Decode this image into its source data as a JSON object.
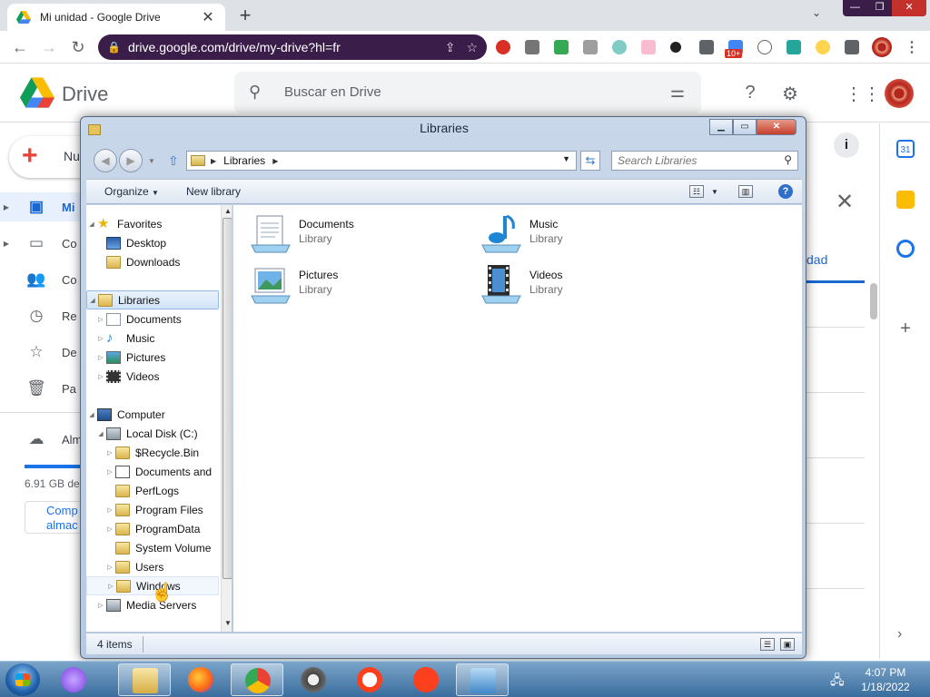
{
  "browser": {
    "tab_title": "Mi unidad - Google Drive",
    "url": "drive.google.com/drive/my-drive?hl=fr",
    "ext_badge": "10+"
  },
  "drive": {
    "app_name": "Drive",
    "search_placeholder": "Buscar en Drive",
    "new_label": "Nu",
    "nav": [
      {
        "label": "Mi",
        "icon": "my-drive-icon"
      },
      {
        "label": "Co",
        "icon": "computers-icon"
      },
      {
        "label": "Co",
        "icon": "shared-icon"
      },
      {
        "label": "Re",
        "icon": "recent-icon"
      },
      {
        "label": "De",
        "icon": "starred-icon"
      },
      {
        "label": "Pa",
        "icon": "trash-icon"
      }
    ],
    "storage_label": "Alm",
    "storage_text": "6.91 GB de",
    "buy_storage_label": "Comp almac",
    "activity_tab": "dad",
    "accent_color": "#1a73e8"
  },
  "explorer": {
    "title": "Libraries",
    "address_crumb": "Libraries",
    "search_placeholder": "Search Libraries",
    "toolbar": {
      "organize": "Organize",
      "new_library": "New library"
    },
    "nav": {
      "favorites": "Favorites",
      "desktop": "Desktop",
      "downloads": "Downloads",
      "libraries": "Libraries",
      "documents": "Documents",
      "music": "Music",
      "pictures": "Pictures",
      "videos": "Videos",
      "computer": "Computer",
      "local_disk": "Local Disk (C:)",
      "recycle": "$Recycle.Bin",
      "docs_and": "Documents and",
      "perflogs": "PerfLogs",
      "program_files": "Program Files",
      "program_data": "ProgramData",
      "system_volume": "System Volume",
      "users": "Users",
      "windows": "Windows",
      "media_servers": "Media Servers"
    },
    "libraries": [
      {
        "name": "Documents",
        "type": "Library"
      },
      {
        "name": "Music",
        "type": "Library"
      },
      {
        "name": "Pictures",
        "type": "Library"
      },
      {
        "name": "Videos",
        "type": "Library"
      }
    ],
    "status": "4 items"
  },
  "taskbar": {
    "time": "4:07 PM",
    "date": "1/18/2022"
  }
}
